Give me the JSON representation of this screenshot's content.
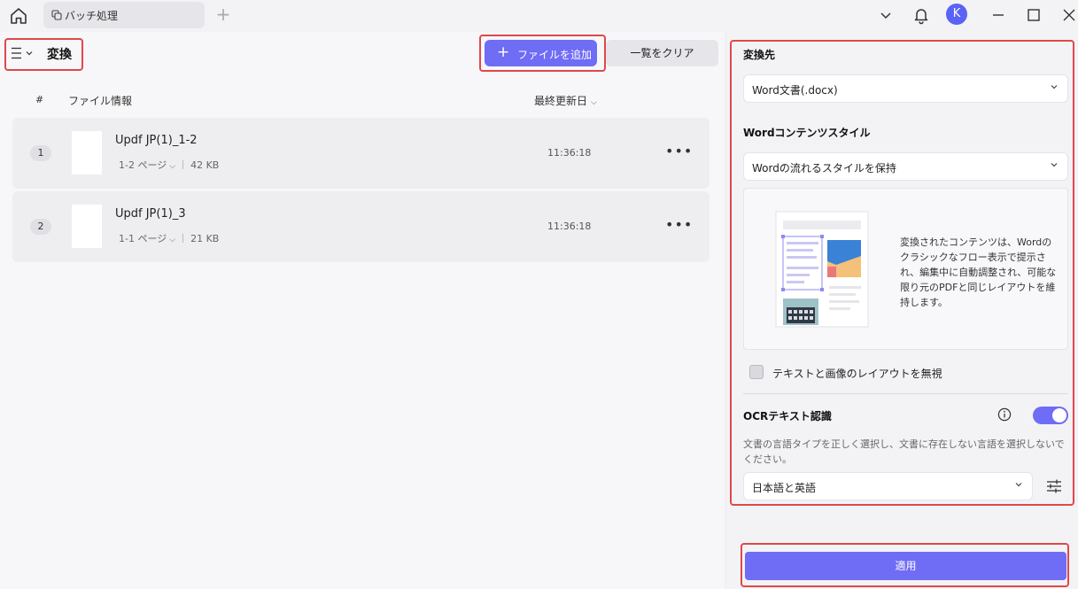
{
  "tab": {
    "label": "バッチ処理"
  },
  "user": {
    "avatar_letter": "K"
  },
  "header": {
    "title": "変換",
    "add_files_label": "ファイルを追加",
    "clear_list_label": "一覧をクリア"
  },
  "table": {
    "col_number": "#",
    "col_file_info": "ファイル情報",
    "col_modified": "最終更新日",
    "rows": [
      {
        "number": "1",
        "name": "Updf JP(1)_1-2",
        "pages": "1-2 ページ",
        "size": "42 KB",
        "time": "11:36:18"
      },
      {
        "number": "2",
        "name": "Updf JP(1)_3",
        "pages": "1-1 ページ",
        "size": "21 KB",
        "time": "11:36:18"
      }
    ]
  },
  "panel": {
    "output_title": "変換先",
    "output_value": "Word文書(.docx)",
    "style_title": "Wordコンテンツスタイル",
    "style_value": "Wordの流れるスタイルを保持",
    "style_description": "変換されたコンテンツは、Wordのクラシックなフロー表示で提示され、編集中に自動調整され、可能な限り元のPDFと同じレイアウトを維持します。",
    "ignore_layout_label": "テキストと画像のレイアウトを無視",
    "ocr_title": "OCRテキスト認識",
    "ocr_enabled": true,
    "ocr_description": "文書の言語タイプを正しく選択し、文書に存在しない言語を選択しないでください。",
    "language_value": "日本語と英語",
    "apply_label": "適用"
  },
  "colors": {
    "accent": "#6f6cf6",
    "highlight": "#e0474c"
  }
}
